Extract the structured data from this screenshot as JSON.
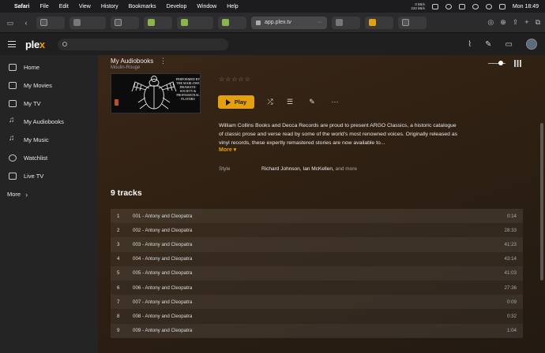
{
  "menubar": {
    "app": "Safari",
    "items": [
      "File",
      "Edit",
      "View",
      "History",
      "Bookmarks",
      "Develop",
      "Window",
      "Help"
    ],
    "net_up": "0 kB/s",
    "net_down": "232 kB/s",
    "clock": "Mon 18:49"
  },
  "browser": {
    "url": "app.plex.tv",
    "url_more": "···"
  },
  "plex": {
    "logo_main": "ple",
    "logo_accent": "x",
    "search_placeholder": ""
  },
  "sidebar": {
    "items": [
      {
        "label": "Home",
        "icon": "home-icon"
      },
      {
        "label": "My Movies",
        "icon": "film-icon"
      },
      {
        "label": "My TV",
        "icon": "tv-icon"
      },
      {
        "label": "My Audiobooks",
        "icon": "music-note-icon"
      },
      {
        "label": "My Music",
        "icon": "music-note-icon"
      },
      {
        "label": "Watchlist",
        "icon": "watchlist-icon"
      },
      {
        "label": "Live TV",
        "icon": "live-tv-icon"
      }
    ],
    "more": "More"
  },
  "album": {
    "library": "My Audiobooks",
    "artist": "Moulin-Rouge",
    "cover_text": "PERFORMED BY THE MARLOWE DRAMATIC SOCIETY & PROFESSIONAL PLAYERS",
    "rating_stars": "☆☆☆☆☆",
    "play_label": "Play",
    "summary": "William Collins Books and Decca Records are proud to present ARGO Classics, a historic catalogue of classic prose and verse read by some of the world's most renowned voices. Originally released as vinyl records, these expertly remastered stories are now available to...",
    "more_label": "More ▾",
    "style_label": "Style",
    "style_value": "Richard Johnson, Ian McKellen,",
    "style_more": " and more"
  },
  "tracks": {
    "heading": "9 tracks",
    "items": [
      {
        "num": "1",
        "name": "001 - Antony and Cleopatra",
        "duration": "0:14"
      },
      {
        "num": "2",
        "name": "002 - Antony and Cleopatra",
        "duration": "28:33"
      },
      {
        "num": "3",
        "name": "003 - Antony and Cleopatra",
        "duration": "41:23"
      },
      {
        "num": "4",
        "name": "004 - Antony and Cleopatra",
        "duration": "43:14"
      },
      {
        "num": "5",
        "name": "005 - Antony and Cleopatra",
        "duration": "41:03"
      },
      {
        "num": "6",
        "name": "006 - Antony and Cleopatra",
        "duration": "27:36"
      },
      {
        "num": "7",
        "name": "007 - Antony and Cleopatra",
        "duration": "0:09"
      },
      {
        "num": "8",
        "name": "008 - Antony and Cleopatra",
        "duration": "0:32"
      },
      {
        "num": "9",
        "name": "009 - Antony and Cleopatra",
        "duration": "1:04"
      }
    ]
  },
  "colors": {
    "accent": "#e5a00d"
  }
}
